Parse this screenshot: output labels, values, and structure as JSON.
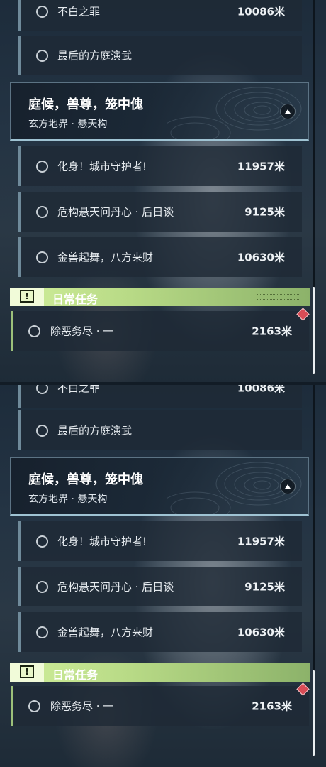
{
  "quests_partial": {
    "title": "不白之罪",
    "distance": "10086米"
  },
  "quests_top": [
    {
      "title": "最后的方庭演武",
      "distance": ""
    }
  ],
  "chapter": {
    "title": "庭候，兽尊，笼中傀",
    "subtitle": "玄方地界 · 悬天构",
    "collapse_icon": "chevron-up-icon"
  },
  "chapter_quests": [
    {
      "title": "化身！城市守护者!",
      "distance": "11957米"
    },
    {
      "title": "危构悬天问丹心 · 后日谈",
      "distance": "9125米"
    },
    {
      "title": "金兽起舞，八方来财",
      "distance": "10630米"
    }
  ],
  "daily": {
    "header": "日常任务",
    "icon": "exclamation-icon",
    "quest": {
      "title": "除恶务尽 · 一",
      "distance": "2163米"
    }
  },
  "colors": {
    "daily_accent": "#b8da86",
    "marker": "#d84c56",
    "row_border": "#6f8a9a"
  }
}
